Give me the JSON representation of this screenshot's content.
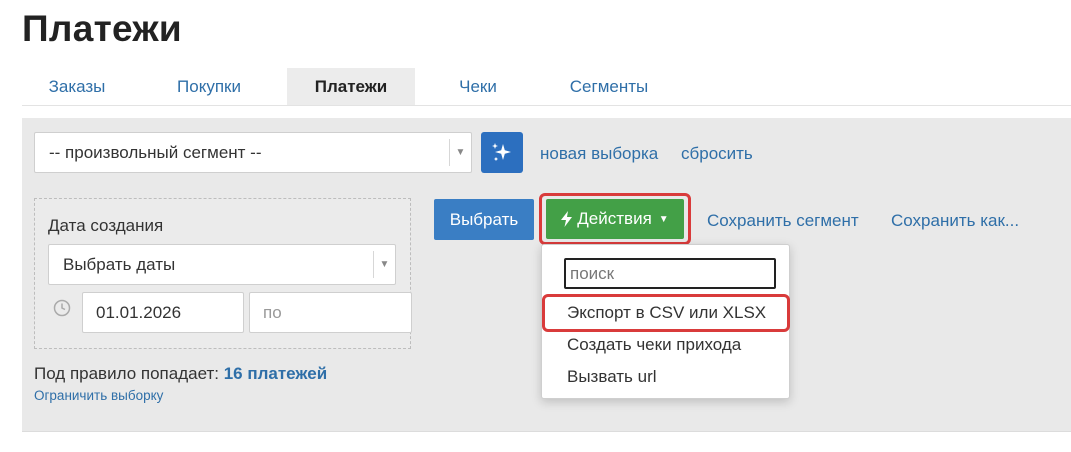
{
  "page": {
    "title": "Платежи"
  },
  "tabs": [
    {
      "label": "Заказы",
      "active": false
    },
    {
      "label": "Покупки",
      "active": false
    },
    {
      "label": "Платежи",
      "active": true
    },
    {
      "label": "Чеки",
      "active": false
    },
    {
      "label": "Сегменты",
      "active": false
    }
  ],
  "segment": {
    "selected": "-- произвольный сегмент --",
    "magic_icon": "sparkles-icon",
    "new_selection_link": "новая выборка",
    "reset_link": "сбросить"
  },
  "filter": {
    "label": "Дата создания",
    "date_select": "Выбрать даты",
    "clock_icon": "clock-icon",
    "date_from": "01.01.2026",
    "date_to_placeholder": "по"
  },
  "toolbar": {
    "choose_button": "Выбрать",
    "actions_button": "Действия",
    "actions_icon": "lightning-icon",
    "save_segment_link": "Сохранить сегмент",
    "save_as_link": "Сохранить как..."
  },
  "actions_menu": {
    "search_placeholder": "поиск",
    "items": [
      "Экспорт в CSV или XLSX",
      "Создать чеки прихода",
      "Вызвать url"
    ]
  },
  "summary": {
    "prefix": "Под правило попадает:",
    "count": "16 платежей",
    "limit_link": "Ограничить выборку"
  },
  "colors": {
    "accent_blue": "#3a7ec4",
    "actions_green": "#43a047",
    "highlight_red": "#d93b3b",
    "link": "#2f6fa8"
  }
}
